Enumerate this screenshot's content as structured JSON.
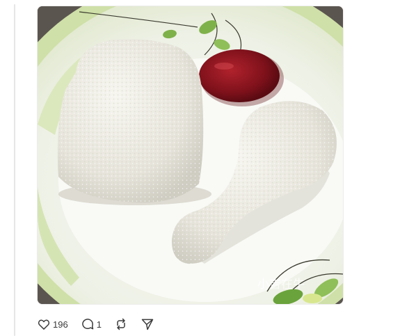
{
  "post": {
    "image": {
      "alt": "",
      "watermark": "小吉在牛"
    },
    "actions": {
      "like": {
        "icon": "heart-icon",
        "count": "196"
      },
      "reply": {
        "icon": "comment-icon",
        "count": "1"
      },
      "repost": {
        "icon": "repost-icon"
      },
      "share": {
        "icon": "send-icon"
      }
    }
  },
  "colors": {
    "plate": "#f3f5ee",
    "plate_rim_green": "#cfe0a8",
    "rice": "#ecebe4",
    "ketchup": "#8a1520",
    "table": "#5b5550",
    "icon": "#3a3a3a"
  }
}
